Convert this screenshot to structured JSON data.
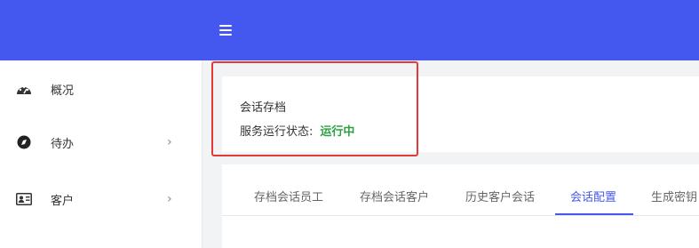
{
  "header": {
    "menu_icon": "hamburger-icon",
    "bg_color": "#4458f0"
  },
  "sidebar": {
    "items": [
      {
        "label": "概况",
        "icon": "dashboard-gauge-icon",
        "has_chevron": false
      },
      {
        "label": "待办",
        "icon": "compass-icon",
        "has_chevron": true
      },
      {
        "label": "客户",
        "icon": "contact-card-icon",
        "has_chevron": true
      }
    ],
    "chevron": "›"
  },
  "status_card": {
    "title": "会话存档",
    "status_label": "服务运行状态:",
    "status_value": "运行中",
    "status_color": "#2ea043"
  },
  "tabs": {
    "items": [
      "存档会话员工",
      "存档会话客户",
      "历史客户会话",
      "会话配置",
      "生成密钥"
    ],
    "active_index": 3,
    "accent": "#4458f0"
  }
}
